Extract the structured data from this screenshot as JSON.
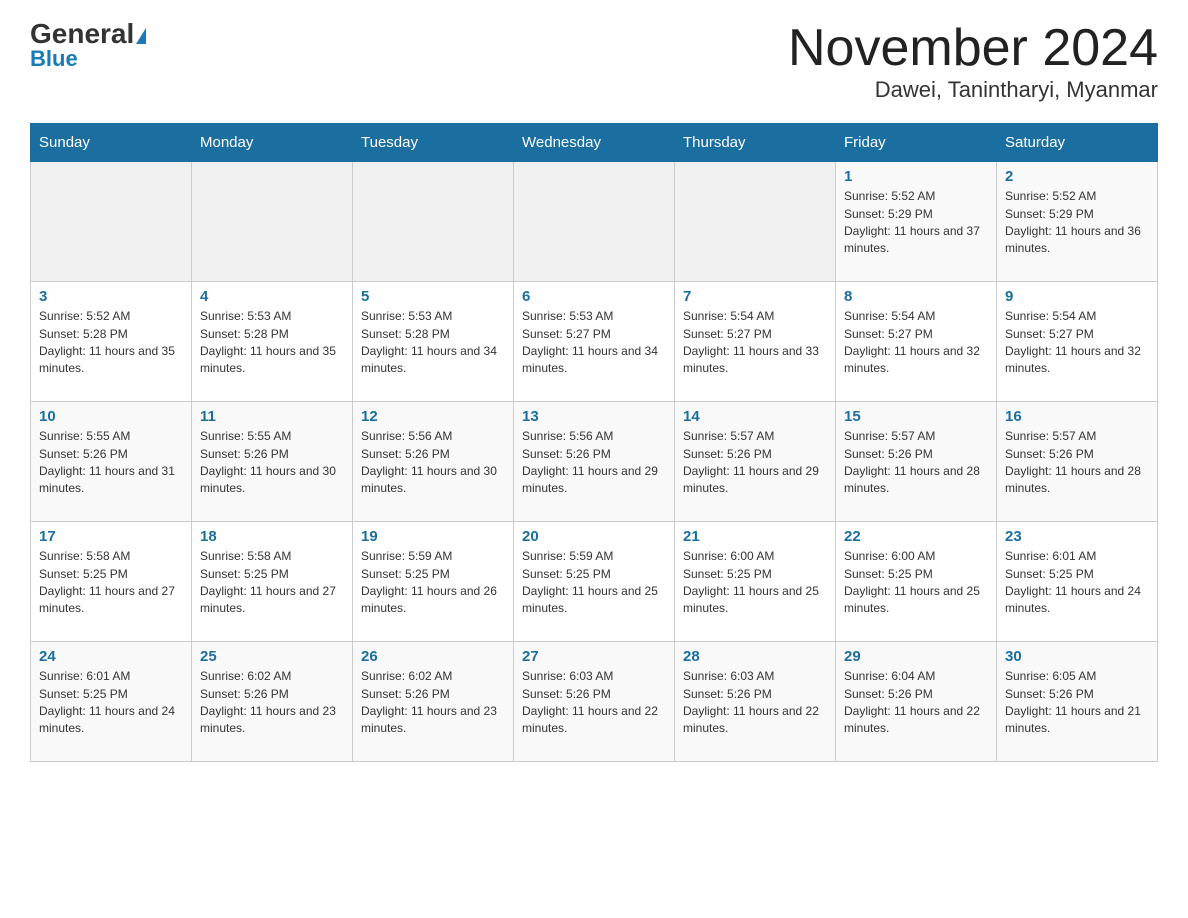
{
  "header": {
    "logo_general": "General",
    "logo_blue": "Blue",
    "title": "November 2024",
    "subtitle": "Dawei, Tanintharyi, Myanmar"
  },
  "calendar": {
    "days_of_week": [
      "Sunday",
      "Monday",
      "Tuesday",
      "Wednesday",
      "Thursday",
      "Friday",
      "Saturday"
    ],
    "weeks": [
      [
        {
          "day": "",
          "empty": true
        },
        {
          "day": "",
          "empty": true
        },
        {
          "day": "",
          "empty": true
        },
        {
          "day": "",
          "empty": true
        },
        {
          "day": "",
          "empty": true
        },
        {
          "day": "1",
          "sunrise": "5:52 AM",
          "sunset": "5:29 PM",
          "daylight": "11 hours and 37 minutes"
        },
        {
          "day": "2",
          "sunrise": "5:52 AM",
          "sunset": "5:29 PM",
          "daylight": "11 hours and 36 minutes"
        }
      ],
      [
        {
          "day": "3",
          "sunrise": "5:52 AM",
          "sunset": "5:28 PM",
          "daylight": "11 hours and 35 minutes"
        },
        {
          "day": "4",
          "sunrise": "5:53 AM",
          "sunset": "5:28 PM",
          "daylight": "11 hours and 35 minutes"
        },
        {
          "day": "5",
          "sunrise": "5:53 AM",
          "sunset": "5:28 PM",
          "daylight": "11 hours and 34 minutes"
        },
        {
          "day": "6",
          "sunrise": "5:53 AM",
          "sunset": "5:27 PM",
          "daylight": "11 hours and 34 minutes"
        },
        {
          "day": "7",
          "sunrise": "5:54 AM",
          "sunset": "5:27 PM",
          "daylight": "11 hours and 33 minutes"
        },
        {
          "day": "8",
          "sunrise": "5:54 AM",
          "sunset": "5:27 PM",
          "daylight": "11 hours and 32 minutes"
        },
        {
          "day": "9",
          "sunrise": "5:54 AM",
          "sunset": "5:27 PM",
          "daylight": "11 hours and 32 minutes"
        }
      ],
      [
        {
          "day": "10",
          "sunrise": "5:55 AM",
          "sunset": "5:26 PM",
          "daylight": "11 hours and 31 minutes"
        },
        {
          "day": "11",
          "sunrise": "5:55 AM",
          "sunset": "5:26 PM",
          "daylight": "11 hours and 30 minutes"
        },
        {
          "day": "12",
          "sunrise": "5:56 AM",
          "sunset": "5:26 PM",
          "daylight": "11 hours and 30 minutes"
        },
        {
          "day": "13",
          "sunrise": "5:56 AM",
          "sunset": "5:26 PM",
          "daylight": "11 hours and 29 minutes"
        },
        {
          "day": "14",
          "sunrise": "5:57 AM",
          "sunset": "5:26 PM",
          "daylight": "11 hours and 29 minutes"
        },
        {
          "day": "15",
          "sunrise": "5:57 AM",
          "sunset": "5:26 PM",
          "daylight": "11 hours and 28 minutes"
        },
        {
          "day": "16",
          "sunrise": "5:57 AM",
          "sunset": "5:26 PM",
          "daylight": "11 hours and 28 minutes"
        }
      ],
      [
        {
          "day": "17",
          "sunrise": "5:58 AM",
          "sunset": "5:25 PM",
          "daylight": "11 hours and 27 minutes"
        },
        {
          "day": "18",
          "sunrise": "5:58 AM",
          "sunset": "5:25 PM",
          "daylight": "11 hours and 27 minutes"
        },
        {
          "day": "19",
          "sunrise": "5:59 AM",
          "sunset": "5:25 PM",
          "daylight": "11 hours and 26 minutes"
        },
        {
          "day": "20",
          "sunrise": "5:59 AM",
          "sunset": "5:25 PM",
          "daylight": "11 hours and 25 minutes"
        },
        {
          "day": "21",
          "sunrise": "6:00 AM",
          "sunset": "5:25 PM",
          "daylight": "11 hours and 25 minutes"
        },
        {
          "day": "22",
          "sunrise": "6:00 AM",
          "sunset": "5:25 PM",
          "daylight": "11 hours and 25 minutes"
        },
        {
          "day": "23",
          "sunrise": "6:01 AM",
          "sunset": "5:25 PM",
          "daylight": "11 hours and 24 minutes"
        }
      ],
      [
        {
          "day": "24",
          "sunrise": "6:01 AM",
          "sunset": "5:25 PM",
          "daylight": "11 hours and 24 minutes"
        },
        {
          "day": "25",
          "sunrise": "6:02 AM",
          "sunset": "5:26 PM",
          "daylight": "11 hours and 23 minutes"
        },
        {
          "day": "26",
          "sunrise": "6:02 AM",
          "sunset": "5:26 PM",
          "daylight": "11 hours and 23 minutes"
        },
        {
          "day": "27",
          "sunrise": "6:03 AM",
          "sunset": "5:26 PM",
          "daylight": "11 hours and 22 minutes"
        },
        {
          "day": "28",
          "sunrise": "6:03 AM",
          "sunset": "5:26 PM",
          "daylight": "11 hours and 22 minutes"
        },
        {
          "day": "29",
          "sunrise": "6:04 AM",
          "sunset": "5:26 PM",
          "daylight": "11 hours and 22 minutes"
        },
        {
          "day": "30",
          "sunrise": "6:05 AM",
          "sunset": "5:26 PM",
          "daylight": "11 hours and 21 minutes"
        }
      ]
    ],
    "labels": {
      "sunrise": "Sunrise:",
      "sunset": "Sunset:",
      "daylight": "Daylight:"
    }
  }
}
